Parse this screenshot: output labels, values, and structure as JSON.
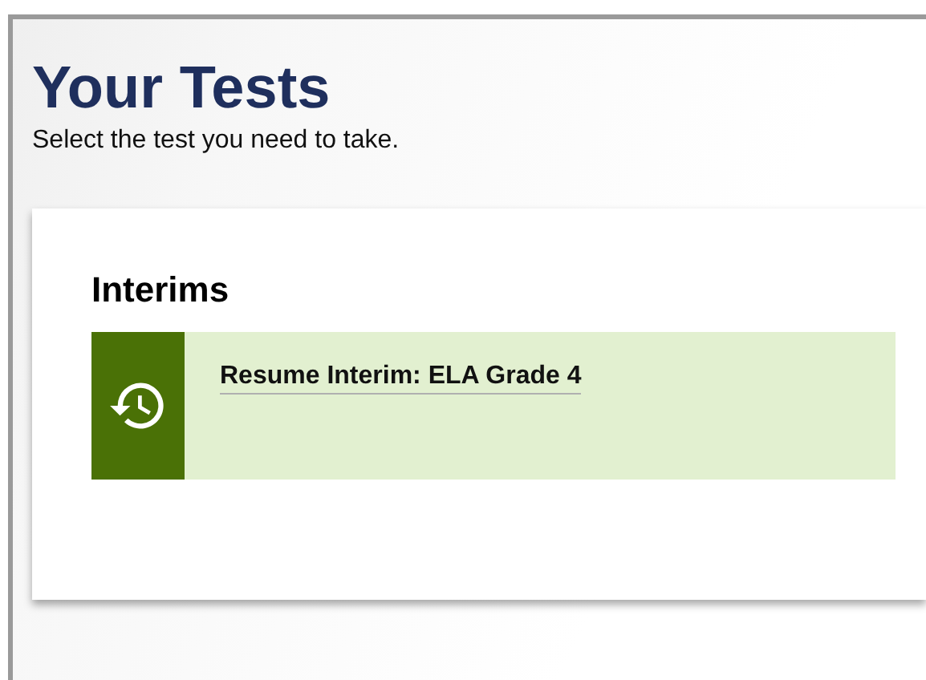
{
  "page": {
    "title": "Your Tests",
    "subtitle": "Select the test you need to take."
  },
  "sections": [
    {
      "heading": "Interims",
      "tests": [
        {
          "label": "Resume Interim: ELA Grade 4",
          "kind": "resume"
        }
      ]
    }
  ]
}
